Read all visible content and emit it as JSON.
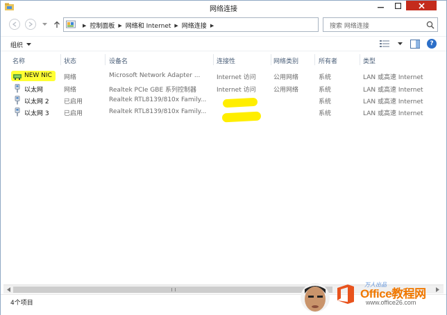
{
  "window": {
    "title": "网络连接",
    "controls": {
      "minimize": "—",
      "maximize": "☐",
      "close": "✕"
    }
  },
  "address": {
    "breadcrumbs": [
      "控制面板",
      "网络和 Internet",
      "网络连接"
    ],
    "search_placeholder": "搜索 网络连接"
  },
  "toolbar": {
    "organize_label": "组织",
    "help_label": "?"
  },
  "columns": [
    "名称",
    "状态",
    "设备名",
    "连接性",
    "网络类别",
    "所有者",
    "类型"
  ],
  "rows": [
    {
      "name": "NEW NIC",
      "status": "网络",
      "device": "Microsoft Network Adapter ...",
      "connectivity": "Internet 访问",
      "category": "公用网络",
      "owner": "系统",
      "type": "LAN 或高速 Internet",
      "icon": "network-connected-icon",
      "highlighted": true
    },
    {
      "name": "以太网",
      "status": "网络",
      "device": "Realtek PCIe GBE 系列控制器",
      "connectivity": "Internet 访问",
      "category": "公用网络",
      "owner": "系统",
      "type": "LAN 或高速 Internet",
      "icon": "ethernet-cable-icon",
      "highlighted": false
    },
    {
      "name": "以太网 2",
      "status": "已启用",
      "device": "Realtek RTL8139/810x Family...",
      "connectivity": "",
      "category": "",
      "owner": "系统",
      "type": "LAN 或高速 Internet",
      "icon": "ethernet-cable-icon",
      "highlighted": false
    },
    {
      "name": "以太网 3",
      "status": "已启用",
      "device": "Realtek RTL8139/810x Family...",
      "connectivity": "",
      "category": "",
      "owner": "系统",
      "type": "LAN 或高速 Internet",
      "icon": "ethernet-cable-icon",
      "highlighted": false
    }
  ],
  "status_bar": {
    "item_count": "4个项目"
  },
  "watermark": {
    "brand": "Office教程网",
    "url": "www.office26.com",
    "handwriting": "万人出品"
  },
  "colors": {
    "highlight": "#ffff33",
    "header_text": "#4c607a",
    "close_button": "#c42b1c",
    "brand_orange": "#f07800"
  }
}
